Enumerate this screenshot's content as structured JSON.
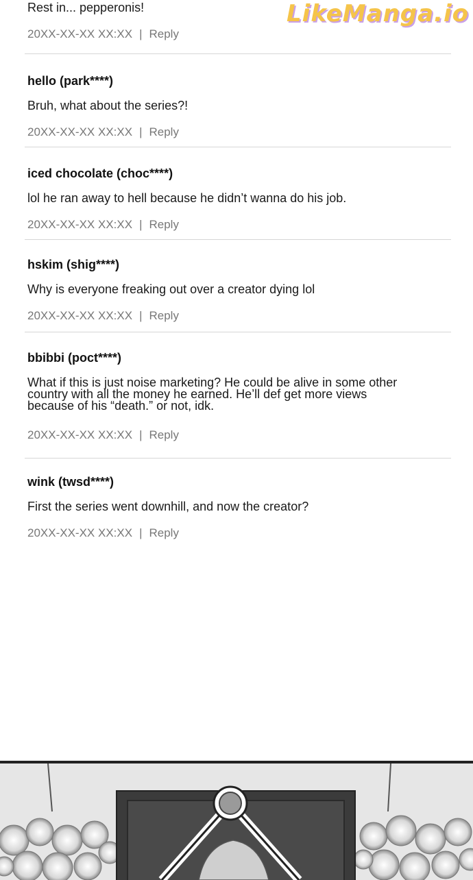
{
  "watermark": "LikeManga.io",
  "comments": [
    {
      "author": "",
      "text": "Rest in... pepperonis!",
      "date": "20XX-XX-XX XX:XX",
      "reply": "Reply"
    },
    {
      "author": "hello (park****)",
      "text": "Bruh, what about the series?!",
      "date": "20XX-XX-XX XX:XX",
      "reply": "Reply"
    },
    {
      "author": "iced chocolate (choc****)",
      "text": "lol he ran away to hell because he didn’t wanna do his job.",
      "date": "20XX-XX-XX XX:XX",
      "reply": "Reply"
    },
    {
      "author": "hskim (shig****)",
      "text": "Why is everyone freaking out over a creator dying lol",
      "date": "20XX-XX-XX XX:XX",
      "reply": "Reply"
    },
    {
      "author": "bbibbi (poct****)",
      "text": "What if this is just noise marketing? He could be alive in some other country with all the money he earned. He’ll def get more views because of his “death.” or not, idk.",
      "date": "20XX-XX-XX XX:XX",
      "reply": "Reply"
    },
    {
      "author": "wink (twsd****)",
      "text": "First the series went downhill, and now the creator?",
      "date": "20XX-XX-XX XX:XX",
      "reply": "Reply"
    }
  ],
  "separator": "|"
}
